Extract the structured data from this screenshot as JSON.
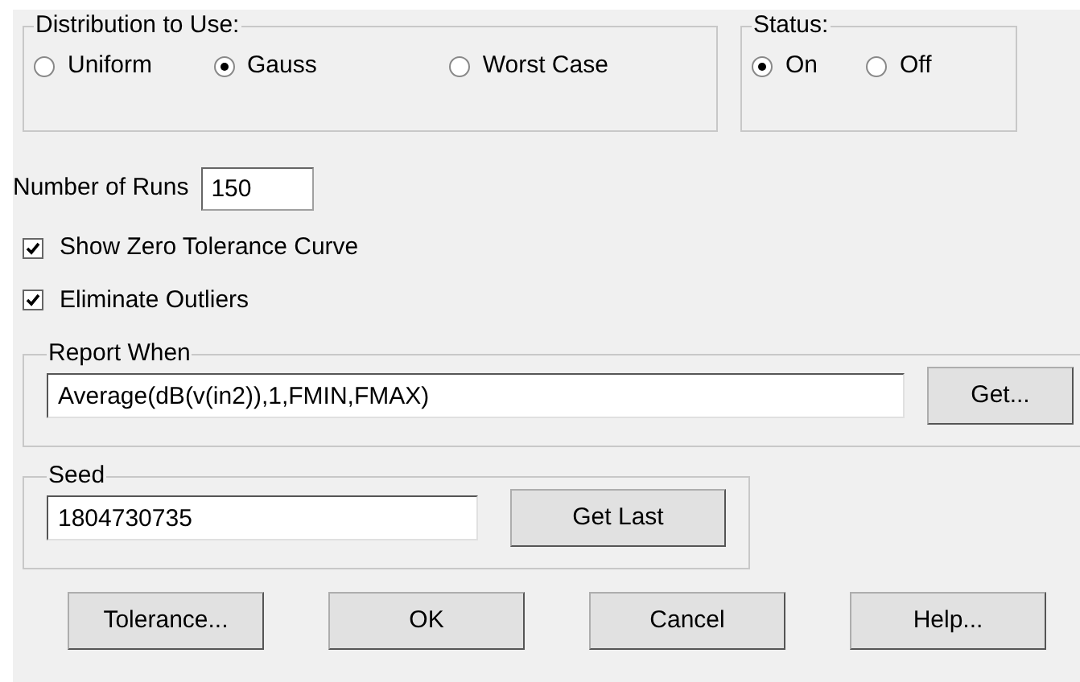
{
  "distribution": {
    "label": "Distribution to Use:",
    "options": [
      {
        "label": "Uniform",
        "selected": false
      },
      {
        "label": "Gauss",
        "selected": true
      },
      {
        "label": "Worst Case",
        "selected": false
      }
    ]
  },
  "status": {
    "label": "Status:",
    "options": [
      {
        "label": "On",
        "selected": true
      },
      {
        "label": "Off",
        "selected": false
      }
    ]
  },
  "runs": {
    "label": "Number of Runs",
    "value": "150"
  },
  "checkboxes": [
    {
      "label": "Show Zero Tolerance Curve",
      "checked": true
    },
    {
      "label": "Eliminate Outliers",
      "checked": true
    }
  ],
  "report_when": {
    "label": "Report When",
    "value": "Average(dB(v(in2)),1,FMIN,FMAX)",
    "button": "Get..."
  },
  "seed": {
    "label": "Seed",
    "value": "1804730735",
    "button": "Get Last"
  },
  "buttons": [
    "Tolerance...",
    "OK",
    "Cancel",
    "Help..."
  ]
}
